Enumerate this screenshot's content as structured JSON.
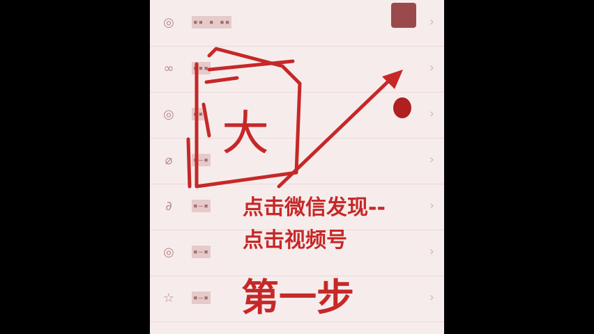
{
  "menu": {
    "rows": [
      {
        "icon_name": "moments-icon",
        "glyph": "◎",
        "label": "▪▪ ▪ ▪▪"
      },
      {
        "icon_name": "channels-icon",
        "glyph": "∞",
        "label": "▪▪▪"
      },
      {
        "icon_name": "live-icon",
        "glyph": "◎",
        "label": "▪▪"
      },
      {
        "icon_name": "scan-icon",
        "glyph": "⌀",
        "label": "▪—▪"
      },
      {
        "icon_name": "shake-icon",
        "glyph": "∂",
        "label": "▪—▪"
      },
      {
        "icon_name": "look-icon",
        "glyph": "◎",
        "label": "▪—▪"
      },
      {
        "icon_name": "search-icon",
        "glyph": "☆",
        "label": "▪—▪"
      }
    ],
    "chevron": "›"
  },
  "annotations": {
    "line1": "点击微信发现--",
    "line2": "点击视频号",
    "step": "第一步",
    "stamp_char": "大"
  },
  "colors": {
    "annotation_red": "#c62828",
    "panel_bg": "#f7ecec"
  }
}
